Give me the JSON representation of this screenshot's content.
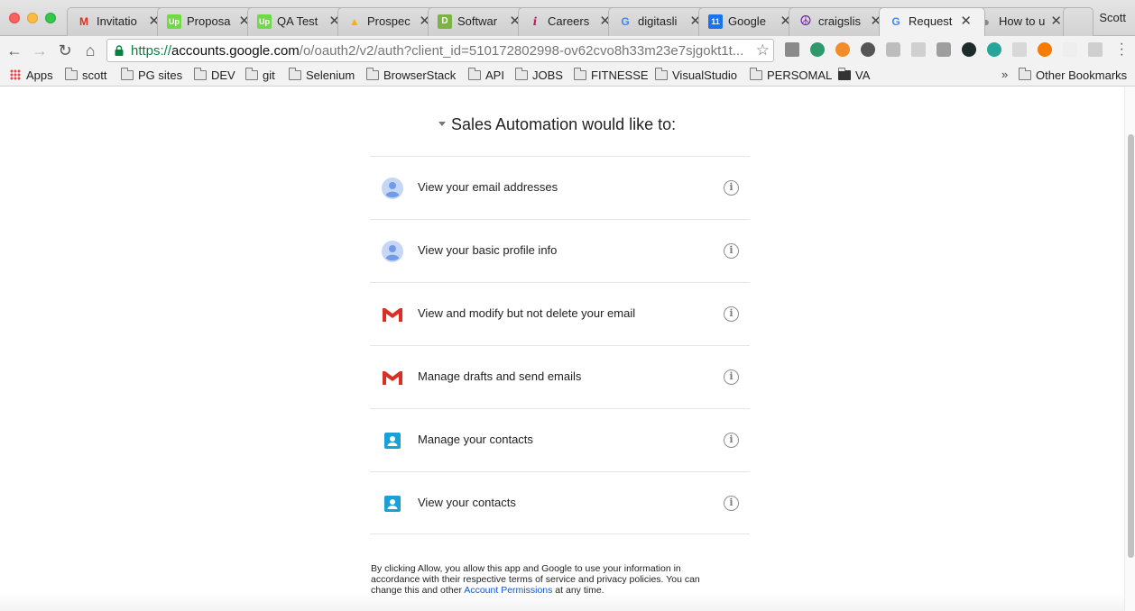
{
  "browser": {
    "tabs": [
      {
        "title": "Invitatio",
        "favicon": "gmail-icon",
        "color": "#d93025"
      },
      {
        "title": "Proposa",
        "favicon": "upwork-icon",
        "color": "#6fda44"
      },
      {
        "title": "QA Test",
        "favicon": "upwork-icon",
        "color": "#6fda44"
      },
      {
        "title": "Prospec",
        "favicon": "drive-icon",
        "color": "#f4b400"
      },
      {
        "title": "Softwar",
        "favicon": "doc-icon",
        "color": "#7cb342"
      },
      {
        "title": "Careers",
        "favicon": "info-icon",
        "color": "#c2185b"
      },
      {
        "title": "digitasli",
        "favicon": "google-icon",
        "color": "#4285f4"
      },
      {
        "title": "Google",
        "favicon": "calendar-icon",
        "color": "#1a73e8"
      },
      {
        "title": "craigslis",
        "favicon": "peace-icon",
        "color": "#6a1b9a"
      },
      {
        "title": "Request",
        "favicon": "google-icon",
        "color": "#4285f4"
      },
      {
        "title": "How to u",
        "favicon": "apple-icon",
        "color": "#888888"
      }
    ],
    "profile_name": "Scott",
    "url": {
      "scheme": "https://",
      "host": "accounts.google.com",
      "path": "/o/oauth2/v2/auth?client_id=510172802998-ov62cvo8h33m23e7sjgokt1t..."
    },
    "bookmarks": [
      "Apps",
      "scott",
      "PG sites",
      "DEV",
      "git",
      "Selenium",
      "BrowserStack",
      "API",
      "JOBS",
      "FITNESSE",
      "VisualStudio",
      "PERSOMAL",
      "VA"
    ],
    "other_bookmarks": "Other Bookmarks",
    "more_bookmarks": "»"
  },
  "consent": {
    "heading": "Sales Automation would like to:",
    "permissions": [
      {
        "label": "View your email addresses",
        "icon": "person-icon"
      },
      {
        "label": "View your basic profile info",
        "icon": "person-icon"
      },
      {
        "label": "View and modify but not delete your email",
        "icon": "gmail-icon"
      },
      {
        "label": "Manage drafts and send emails",
        "icon": "gmail-icon"
      },
      {
        "label": "Manage your contacts",
        "icon": "contacts-icon"
      },
      {
        "label": "View your contacts",
        "icon": "contacts-icon"
      }
    ],
    "disclaimer_before": "By clicking Allow, you allow this app and Google to use your information in accordance with their respective terms of service and privacy policies. You can change this and other ",
    "disclaimer_link": "Account Permissions",
    "disclaimer_after": " at any time."
  },
  "colors": {
    "link": "#1155cc",
    "gmail_red": "#d93025",
    "contacts_blue": "#1a9fd6",
    "person_bg": "#c6d7f5",
    "person_fg": "#6f9be8"
  }
}
